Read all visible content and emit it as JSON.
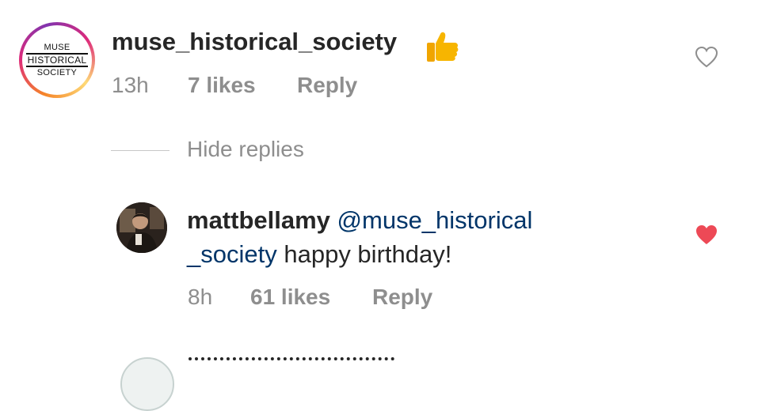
{
  "comment": {
    "avatar_lines": [
      "MUSE",
      "HISTORICAL",
      "SOCIETY"
    ],
    "username": "muse_historical_society",
    "emoji": "👍",
    "time": "13h",
    "likes": "7 likes",
    "reply_label": "Reply",
    "liked": false
  },
  "hide_replies_label": "Hide replies",
  "reply": {
    "username": "mattbellamy",
    "mention": "@muse_historical_society",
    "mention_line1": "@muse_historical",
    "mention_line2": "_society",
    "text": "happy birthday!",
    "time": "8h",
    "likes": "61 likes",
    "reply_label": "Reply",
    "liked": true
  },
  "colors": {
    "heart_liked": "#ed4956",
    "heart_outline": "#8e8e8e",
    "mention": "#003569",
    "meta": "#8e8e8e",
    "thumb": "#f7b500"
  }
}
